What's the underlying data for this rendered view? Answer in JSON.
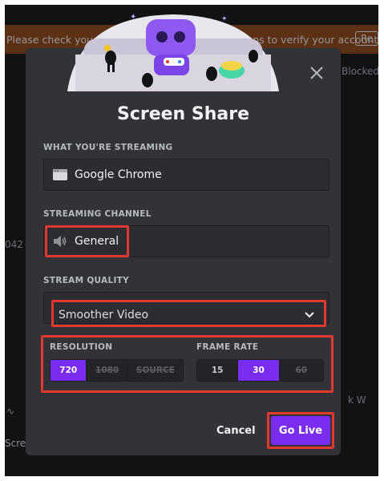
{
  "background": {
    "banner_text": "Please check your email and follow the instructions to verify your account.",
    "banner_button": "Re",
    "blocked_label": "Blocked",
    "left_number": "042",
    "left_label": "Scree",
    "right_label": "k W"
  },
  "modal": {
    "title": "Screen Share",
    "streaming_label": "WHAT YOU'RE STREAMING",
    "streaming_app": "Google Chrome",
    "channel_label": "STREAMING CHANNEL",
    "channel_name": "General",
    "quality_label": "STREAM QUALITY",
    "quality_selected": "Smoother Video",
    "resolution_label": "RESOLUTION",
    "resolution_options": [
      "720",
      "1080",
      "SOURCE"
    ],
    "resolution_selected": "720",
    "framerate_label": "FRAME RATE",
    "framerate_options": [
      "15",
      "30",
      "60"
    ],
    "framerate_selected": "30",
    "cancel_label": "Cancel",
    "golive_label": "Go Live"
  },
  "colors": {
    "accent": "#7a2cf0",
    "highlight": "#e2392f",
    "modal_bg": "#313338"
  }
}
